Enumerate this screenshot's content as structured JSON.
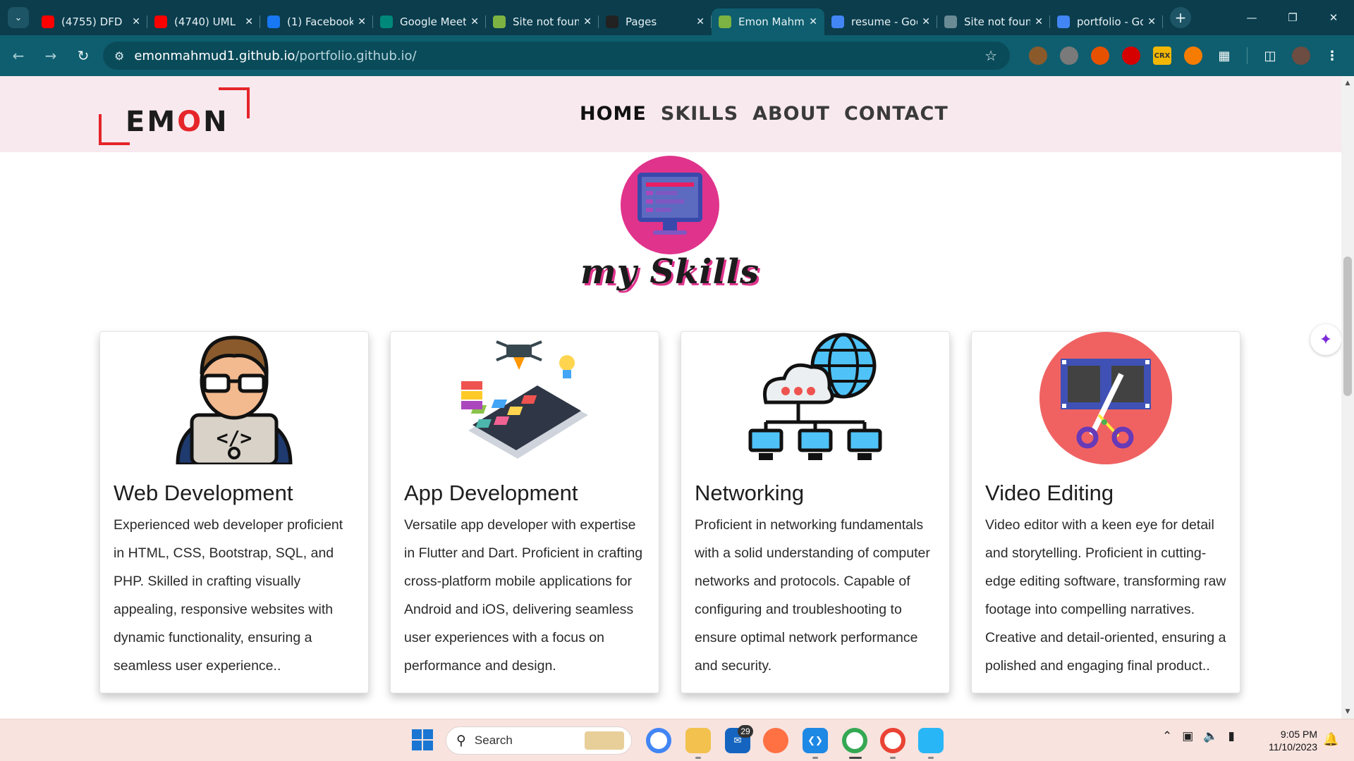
{
  "browser": {
    "tabs": [
      {
        "title": "(4755) DFD",
        "favicon": "youtube-icon",
        "color": "#ff0000",
        "active": false
      },
      {
        "title": "(4740) UML",
        "favicon": "youtube-icon",
        "color": "#ff0000",
        "active": false
      },
      {
        "title": "(1) Facebook",
        "favicon": "facebook-icon",
        "color": "#1877f2",
        "active": false
      },
      {
        "title": "Google Meet",
        "favicon": "google-meet-icon",
        "color": "#00897b",
        "active": false
      },
      {
        "title": "Site not found",
        "favicon": "site-icon",
        "color": "#7cb342",
        "active": false
      },
      {
        "title": "Pages",
        "favicon": "github-icon",
        "color": "#222222",
        "active": false
      },
      {
        "title": "Emon Mahmud",
        "favicon": "site-icon",
        "color": "#7cb342",
        "active": true
      },
      {
        "title": "resume - Google",
        "favicon": "google-icon",
        "color": "#4285f4",
        "active": false
      },
      {
        "title": "Site not found",
        "favicon": "globe-icon",
        "color": "#6b8b94",
        "active": false
      },
      {
        "title": "portfolio - Google",
        "favicon": "google-icon",
        "color": "#4285f4",
        "active": false
      }
    ],
    "url_host": "emonmahmud1.github.io",
    "url_path": "/portfolio.github.io/"
  },
  "site": {
    "logo": {
      "pre": "EM",
      "o": "O",
      "post": "N"
    },
    "nav": [
      "HOME",
      "SKILLS",
      "ABOUT",
      "CONTACT"
    ],
    "skills_heading": "my Skills"
  },
  "cards": [
    {
      "title": "Web Development",
      "text": "Experienced web developer proficient in HTML, CSS, Bootstrap, SQL, and PHP. Skilled in crafting visually appealing, responsive websites with dynamic functionality, ensuring a seamless user experience.."
    },
    {
      "title": "App Development",
      "text": "Versatile app developer with expertise in Flutter and Dart. Proficient in crafting cross-platform mobile applications for Android and iOS, delivering seamless user experiences with a focus on performance and design."
    },
    {
      "title": "Networking",
      "text": "Proficient in networking fundamentals with a solid understanding of computer networks and protocols. Capable of configuring and troubleshooting to ensure optimal network performance and security."
    },
    {
      "title": "Video Editing",
      "text": "Video editor with a keen eye for detail and storytelling. Proficient in cutting-edge editing software, transforming raw footage into compelling narratives. Creative and detail-oriented, ensuring a polished and engaging final product.."
    }
  ],
  "taskbar": {
    "search_label": "Search",
    "mail_badge": "29",
    "time": "9:05 PM",
    "date": "11/10/2023"
  }
}
